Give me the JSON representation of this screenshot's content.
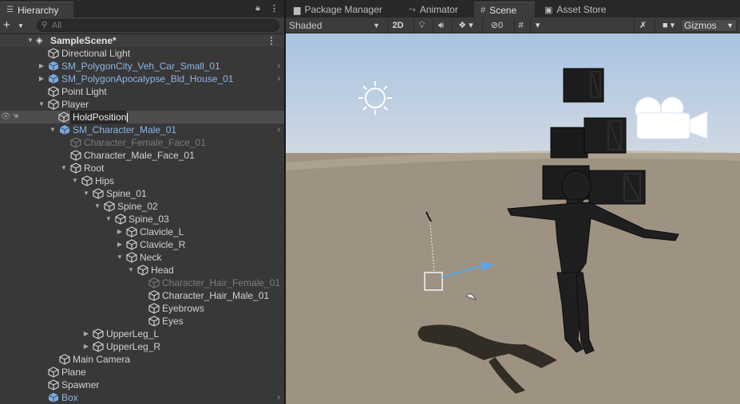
{
  "hierarchy": {
    "tab_label": "Hierarchy",
    "search_placeholder": "All",
    "scene_name": "SampleScene*",
    "rows": [
      {
        "label": "Directional Light"
      },
      {
        "label": "SM_PolygonCity_Veh_Car_Small_01"
      },
      {
        "label": "SM_PolygonApocalypse_Bld_House_01"
      },
      {
        "label": "Point Light"
      },
      {
        "label": "Player"
      },
      {
        "label": "HoldPosition"
      },
      {
        "label": "SM_Character_Male_01"
      },
      {
        "label": "Character_Female_Face_01"
      },
      {
        "label": "Character_Male_Face_01"
      },
      {
        "label": "Root"
      },
      {
        "label": "Hips"
      },
      {
        "label": "Spine_01"
      },
      {
        "label": "Spine_02"
      },
      {
        "label": "Spine_03"
      },
      {
        "label": "Clavicle_L"
      },
      {
        "label": "Clavicle_R"
      },
      {
        "label": "Neck"
      },
      {
        "label": "Head"
      },
      {
        "label": "Character_Hair_Female_01"
      },
      {
        "label": "Character_Hair_Male_01"
      },
      {
        "label": "Eyebrows"
      },
      {
        "label": "Eyes"
      },
      {
        "label": "UpperLeg_L"
      },
      {
        "label": "UpperLeg_R"
      },
      {
        "label": "Main Camera"
      },
      {
        "label": "Plane"
      },
      {
        "label": "Spawner"
      },
      {
        "label": "Box"
      }
    ]
  },
  "tabs": {
    "package_manager": "Package Manager",
    "animator": "Animator",
    "scene": "Scene",
    "asset_store": "Asset Store"
  },
  "scene_toolbar": {
    "draw_mode": "Shaded",
    "mode_2d": "2D",
    "hidden_count": "0",
    "gizmos": "Gizmos"
  },
  "colors": {
    "panel_bg": "#383838",
    "selection": "#4d4d4d",
    "prefab_text": "#8eb5e6",
    "sky": "#b9cde4",
    "ground": "#9e9382"
  }
}
